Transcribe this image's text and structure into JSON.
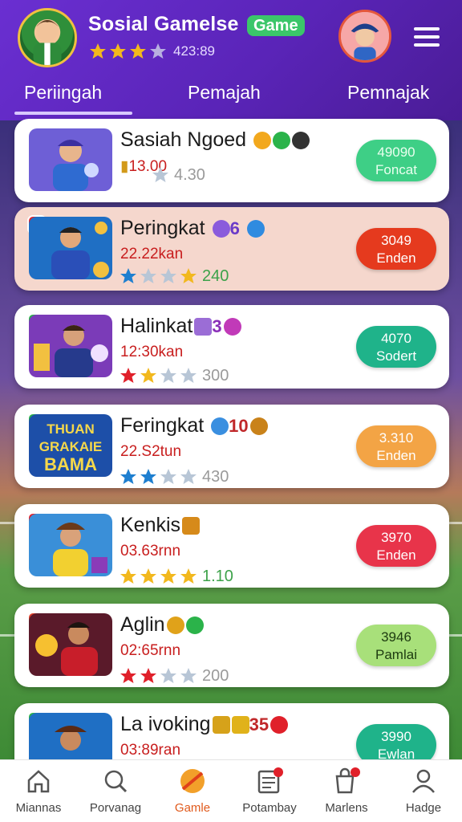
{
  "header": {
    "title": "Sosial Gamelse",
    "badge": "Game",
    "rating_value": "423:89",
    "rating_stars": 3.5,
    "avatar_icon": "player-avatar-icon",
    "profile_icon": "profile-avatar-icon",
    "menu_icon": "hamburger-menu-icon"
  },
  "tabs": [
    {
      "label": "Periingah",
      "active": true
    },
    {
      "label": "Pemajah",
      "active": false
    },
    {
      "label": "Pemnajak",
      "active": false
    }
  ],
  "list": [
    {
      "title": "Sasiah Ngoed",
      "extra": "",
      "subtitle": "13.00",
      "stars_value": "4.30",
      "stars_filled": 0,
      "button_top": "49090",
      "button_bottom": "Foncat",
      "button_color": "#3ecf86",
      "button_text_color": "#eaffef"
    },
    {
      "title": "Peringkat",
      "extra": "6",
      "subtitle": "22.22kan",
      "stars_value": "240",
      "stars_filled": 1,
      "button_top": "3049",
      "button_bottom": "Enden",
      "button_color": "#e53a1e",
      "button_text_color": "#ffffff"
    },
    {
      "title": "Halinkat",
      "extra": "3",
      "subtitle": "12:30kan",
      "stars_value": "300",
      "stars_filled": 2,
      "button_top": "4070",
      "button_bottom": "Sodert",
      "button_color": "#1fb38a",
      "button_text_color": "#ffffff"
    },
    {
      "title": "Feringkat",
      "extra": "10",
      "subtitle": "22.S2tun",
      "stars_value": "430",
      "stars_filled": 2,
      "button_top": "3.310",
      "button_bottom": "Enden",
      "button_color": "#f3a445",
      "button_text_color": "#ffffff"
    },
    {
      "title": "Kenkis",
      "extra": "",
      "subtitle": "03.63rnn",
      "stars_value": "1.10",
      "stars_filled": 4,
      "button_top": "3970",
      "button_bottom": "Enden",
      "button_color": "#e8344a",
      "button_text_color": "#ffffff"
    },
    {
      "title": "Aglin",
      "extra": "",
      "subtitle": "02:65rnn",
      "stars_value": "200",
      "stars_filled": 2,
      "button_top": "3946",
      "button_bottom": "Pamlai",
      "button_color": "#a8e07a",
      "button_text_color": "#1d3b10"
    },
    {
      "title": "La ivoking",
      "extra": "35",
      "subtitle": "03:89ran",
      "stars_value": "",
      "stars_filled": 0,
      "button_top": "3990",
      "button_bottom": "Ewlan",
      "button_color": "#1fb38a",
      "button_text_color": "#ffffff"
    }
  ],
  "thumb_art": {
    "thumb_4_text_1": "THUAN",
    "thumb_4_text_2": "GRAKAIE",
    "thumb_4_text_3": "BAMA"
  },
  "bottom_nav": [
    {
      "label": "Miannas",
      "icon": "home-icon",
      "active": false
    },
    {
      "label": "Porvanag",
      "icon": "search-icon",
      "active": false
    },
    {
      "label": "Gamle",
      "icon": "game-ball-icon",
      "active": true
    },
    {
      "label": "Potambay",
      "icon": "news-icon",
      "active": false
    },
    {
      "label": "Marlens",
      "icon": "shopping-bag-icon",
      "active": false
    },
    {
      "label": "Hadge",
      "icon": "profile-icon",
      "active": false
    }
  ],
  "colors": {
    "header_purple": "#5a24b8",
    "highlight_card": "#f5d7cd",
    "star_gold": "#f2b81d",
    "star_blue": "#1e7fd0",
    "star_red": "#e0202a",
    "subtitle_red": "#c81e1e",
    "active_nav": "#e05a1c"
  }
}
